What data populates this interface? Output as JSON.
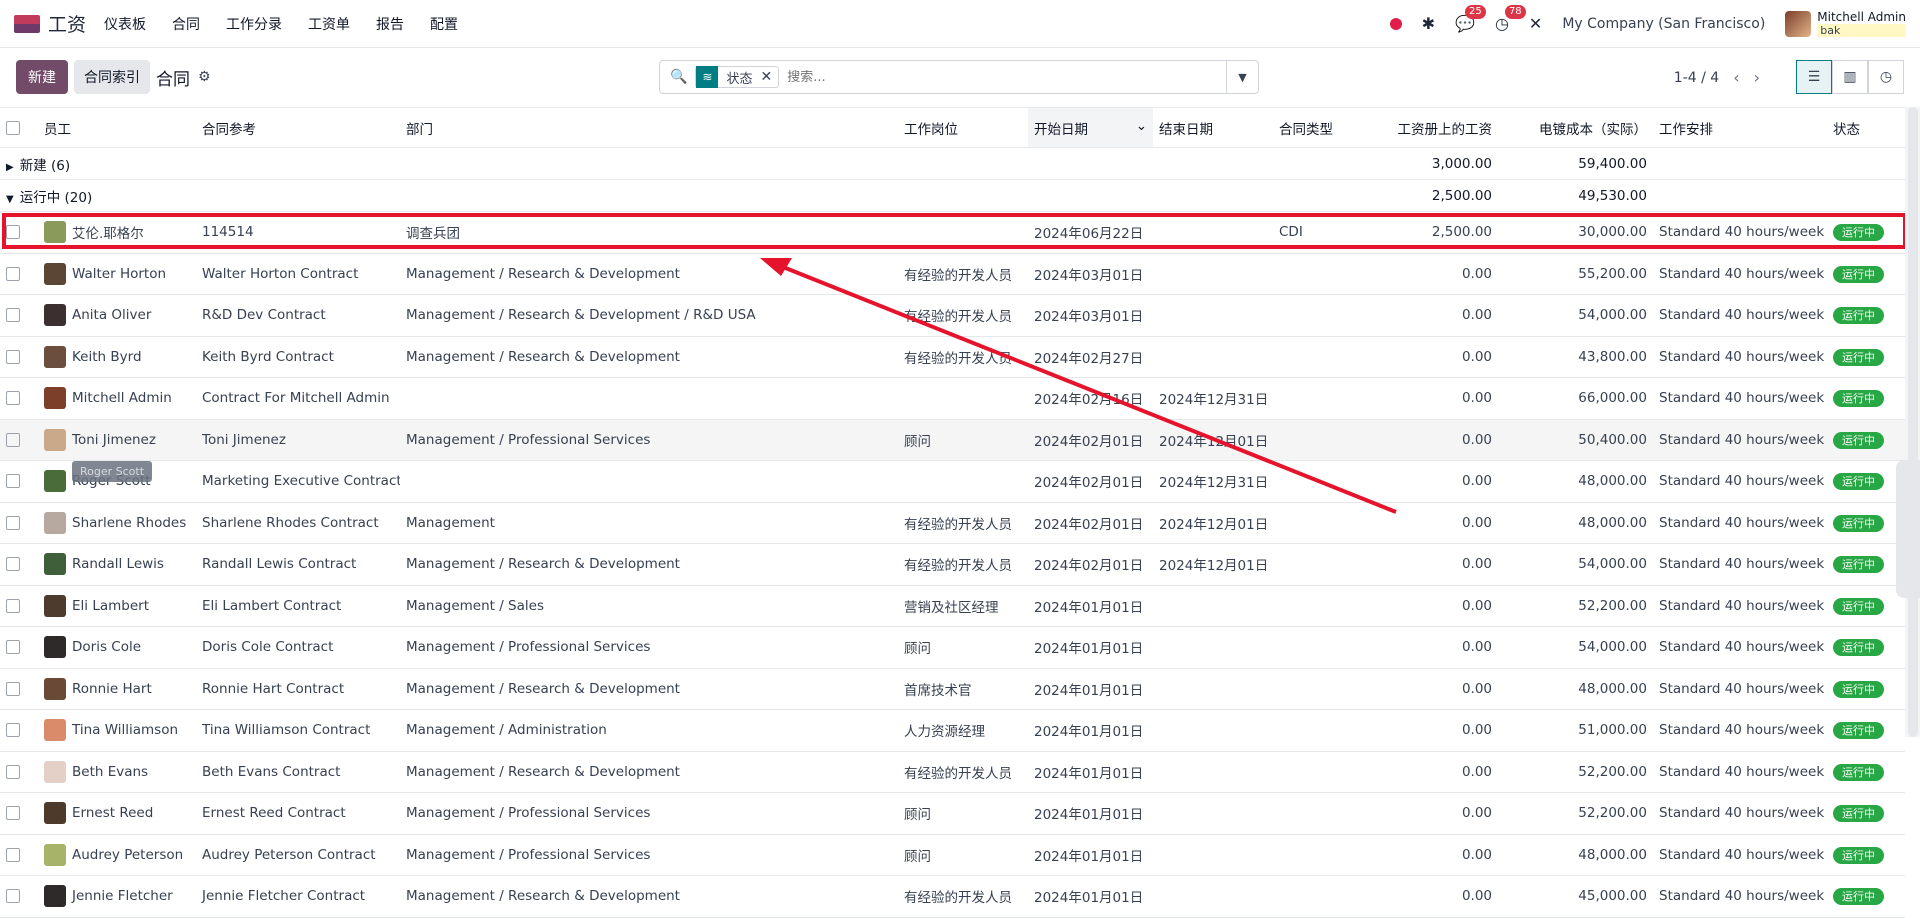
{
  "app": {
    "name": "工资"
  },
  "menu": [
    "仪表板",
    "合同",
    "工作分录",
    "工资单",
    "报告",
    "配置"
  ],
  "nav": {
    "chat_count": "25",
    "activity_count": "78",
    "company": "My Company (San Francisco)",
    "user_name": "Mitchell Admin",
    "user_db": "bak"
  },
  "control": {
    "new_label": "新建",
    "index_label": "合同索引",
    "title": "合同",
    "facet": "状态",
    "search_placeholder": "搜索...",
    "pager": "1-4 / 4"
  },
  "columns": [
    "员工",
    "合同参考",
    "部门",
    "工作岗位",
    "开始日期",
    "结束日期",
    "合同类型",
    "工资册上的工资",
    "电镀成本（实际）",
    "工作安排",
    "状态"
  ],
  "groups": [
    {
      "label": "新建 (6)",
      "wage": "3,000.00",
      "cost": "59,400.00"
    },
    {
      "label": "运行中 (20)",
      "wage": "2,500.00",
      "cost": "49,530.00"
    }
  ],
  "rows": [
    {
      "employee": "艾伦.耶格尔",
      "ref": "114514",
      "dept": "调查兵团",
      "job": "",
      "start": "2024年06月22日",
      "end": "",
      "type": "CDI",
      "wage": "2,500.00",
      "cost": "30,000.00",
      "schedule": "Standard 40 hours/week",
      "status": "运行中",
      "color": "#8a9a5b"
    },
    {
      "employee": "Walter Horton",
      "ref": "Walter Horton Contract",
      "dept": "Management / Research & Development",
      "job": "有经验的开发人员",
      "start": "2024年03月01日",
      "end": "",
      "type": "",
      "wage": "0.00",
      "cost": "55,200.00",
      "schedule": "Standard 40 hours/week",
      "status": "运行中",
      "color": "#5b4636"
    },
    {
      "employee": "Anita Oliver",
      "ref": "R&D Dev Contract",
      "dept": "Management / Research & Development / R&D USA",
      "job": "有经验的开发人员",
      "start": "2024年03月01日",
      "end": "",
      "type": "",
      "wage": "0.00",
      "cost": "54,000.00",
      "schedule": "Standard 40 hours/week",
      "status": "运行中",
      "color": "#3b2f2f"
    },
    {
      "employee": "Keith Byrd",
      "ref": "Keith Byrd Contract",
      "dept": "Management / Research & Development",
      "job": "有经验的开发人员",
      "start": "2024年02月27日",
      "end": "",
      "type": "",
      "wage": "0.00",
      "cost": "43,800.00",
      "schedule": "Standard 40 hours/week",
      "status": "运行中",
      "color": "#6b4e3d"
    },
    {
      "employee": "Mitchell Admin",
      "ref": "Contract For Mitchell Admin",
      "dept": "",
      "job": "",
      "start": "2024年02月16日",
      "end": "2024年12月31日",
      "type": "",
      "wage": "0.00",
      "cost": "66,000.00",
      "schedule": "Standard 40 hours/week",
      "status": "运行中",
      "color": "#7b3f2a"
    },
    {
      "employee": "Toni Jimenez",
      "ref": "Toni Jimenez",
      "dept": "Management / Professional Services",
      "job": "顾问",
      "start": "2024年02月01日",
      "end": "2024年12月01日",
      "type": "",
      "wage": "0.00",
      "cost": "50,400.00",
      "schedule": "Standard 40 hours/week",
      "status": "运行中",
      "color": "#c9a98a"
    },
    {
      "employee": "Roger Scott",
      "ref": "Marketing Executive Contract",
      "dept": "",
      "job": "",
      "start": "2024年02月01日",
      "end": "2024年12月31日",
      "type": "",
      "wage": "0.00",
      "cost": "48,000.00",
      "schedule": "Standard 40 hours/week",
      "status": "运行中",
      "color": "#4a6b3a"
    },
    {
      "employee": "Sharlene Rhodes",
      "ref": "Sharlene Rhodes Contract",
      "dept": "Management",
      "job": "有经验的开发人员",
      "start": "2024年02月01日",
      "end": "2024年12月01日",
      "type": "",
      "wage": "0.00",
      "cost": "48,000.00",
      "schedule": "Standard 40 hours/week",
      "status": "运行中",
      "color": "#b7a9a0"
    },
    {
      "employee": "Randall Lewis",
      "ref": "Randall Lewis Contract",
      "dept": "Management / Research & Development",
      "job": "有经验的开发人员",
      "start": "2024年02月01日",
      "end": "2024年12月01日",
      "type": "",
      "wage": "0.00",
      "cost": "54,000.00",
      "schedule": "Standard 40 hours/week",
      "status": "运行中",
      "color": "#3f5f3a"
    },
    {
      "employee": "Eli Lambert",
      "ref": "Eli Lambert Contract",
      "dept": "Management / Sales",
      "job": "营销及社区经理",
      "start": "2024年01月01日",
      "end": "",
      "type": "",
      "wage": "0.00",
      "cost": "52,200.00",
      "schedule": "Standard 40 hours/week",
      "status": "运行中",
      "color": "#4d3b2e"
    },
    {
      "employee": "Doris Cole",
      "ref": "Doris Cole Contract",
      "dept": "Management / Professional Services",
      "job": "顾问",
      "start": "2024年01月01日",
      "end": "",
      "type": "",
      "wage": "0.00",
      "cost": "54,000.00",
      "schedule": "Standard 40 hours/week",
      "status": "运行中",
      "color": "#2e2a2a"
    },
    {
      "employee": "Ronnie Hart",
      "ref": "Ronnie Hart Contract",
      "dept": "Management / Research & Development",
      "job": "首席技术官",
      "start": "2024年01月01日",
      "end": "",
      "type": "",
      "wage": "0.00",
      "cost": "48,000.00",
      "schedule": "Standard 40 hours/week",
      "status": "运行中",
      "color": "#6a4a36"
    },
    {
      "employee": "Tina Williamson",
      "ref": "Tina Williamson Contract",
      "dept": "Management / Administration",
      "job": "人力资源经理",
      "start": "2024年01月01日",
      "end": "",
      "type": "",
      "wage": "0.00",
      "cost": "51,000.00",
      "schedule": "Standard 40 hours/week",
      "status": "运行中",
      "color": "#d98b6a"
    },
    {
      "employee": "Beth Evans",
      "ref": "Beth Evans Contract",
      "dept": "Management / Research & Development",
      "job": "有经验的开发人员",
      "start": "2024年01月01日",
      "end": "",
      "type": "",
      "wage": "0.00",
      "cost": "52,200.00",
      "schedule": "Standard 40 hours/week",
      "status": "运行中",
      "color": "#e5d0c8"
    },
    {
      "employee": "Ernest Reed",
      "ref": "Ernest Reed Contract",
      "dept": "Management / Professional Services",
      "job": "顾问",
      "start": "2024年01月01日",
      "end": "",
      "type": "",
      "wage": "0.00",
      "cost": "52,200.00",
      "schedule": "Standard 40 hours/week",
      "status": "运行中",
      "color": "#4e3a2a"
    },
    {
      "employee": "Audrey Peterson",
      "ref": "Audrey Peterson Contract",
      "dept": "Management / Professional Services",
      "job": "顾问",
      "start": "2024年01月01日",
      "end": "",
      "type": "",
      "wage": "0.00",
      "cost": "48,000.00",
      "schedule": "Standard 40 hours/week",
      "status": "运行中",
      "color": "#a8b36a"
    },
    {
      "employee": "Jennie Fletcher",
      "ref": "Jennie Fletcher Contract",
      "dept": "Management / Research & Development",
      "job": "有经验的开发人员",
      "start": "2024年01月01日",
      "end": "",
      "type": "",
      "wage": "0.00",
      "cost": "45,000.00",
      "schedule": "Standard 40 hours/week",
      "status": "运行中",
      "color": "#2f2a2a"
    }
  ],
  "tooltip": "Roger Scott",
  "annotation_color": "#e5132b"
}
